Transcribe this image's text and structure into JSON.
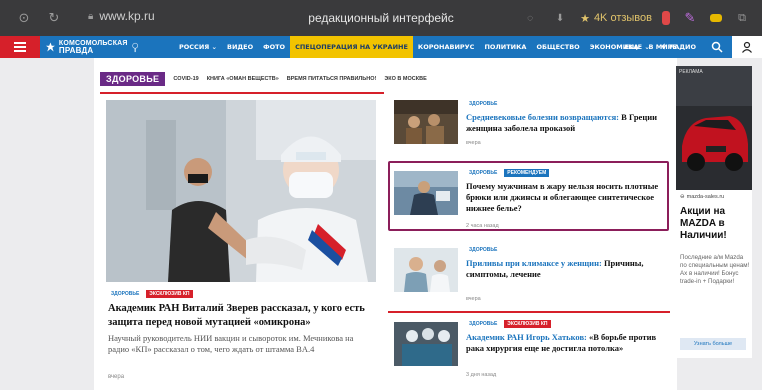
{
  "browser": {
    "url": "www.kp.ru",
    "tab_title": "редакционный интерфейс",
    "reviews": "4K отзывов"
  },
  "header": {
    "logo_line1": "КОМСОМОЛЬСКАЯ",
    "logo_line2": "ПРАВДА",
    "region": "РОССИЯ",
    "nav": [
      "ВИДЕО",
      "ФОТО",
      "СПЕЦОПЕРАЦИЯ НА УКРАИНЕ",
      "КОРОНАВИРУС",
      "ПОЛИТИКА",
      "ОБЩЕСТВО",
      "ЭКОНОМИКА",
      "В МИРЕ"
    ],
    "more": "ЕЩЕ",
    "radio": "РАДИО",
    "colors": {
      "blue": "#1b74bd",
      "red": "#d6202a",
      "special": "#f2c300"
    }
  },
  "section": {
    "rubric": "ЗДОРОВЬЕ",
    "subtags": [
      "COVID-19",
      "КНИГА «ОМАН ВЕЩЕСТВ»",
      "ВРЕМЯ ПИТАТЬСЯ ПРАВИЛЬНО!",
      "ЭКО В МОСКВЕ"
    ]
  },
  "main_story": {
    "tag1": "ЗДОРОВЬЕ",
    "tag2": "ЭКСКЛЮЗИВ КП",
    "title": "Академик РАН Виталий Зверев рассказал, у кого есть защита перед новой мутацией «омикрона»",
    "lead": "Научный руководитель НИИ вакцин и сывороток им. Мечникова на радио «КП» рассказал о том, чего ждать от штамма BA.4",
    "time": "вчера"
  },
  "cards": [
    {
      "tag1": "ЗДОРОВЬЕ",
      "tag2": "",
      "title_link": "Средневековые болезни возвращаются:",
      "title_rest": " В Греции женщина заболела проказой",
      "time": "вчера"
    },
    {
      "tag1": "ЗДОРОВЬЕ",
      "tag2": "РЕКОМЕНДУЕМ",
      "title_link": "",
      "title_rest": "Почему мужчинам в жару нельзя носить плотные брюки или джинсы и облегающее синтетическое нижнее белье?",
      "time": "2 часа назад"
    },
    {
      "tag1": "ЗДОРОВЬЕ",
      "tag2": "",
      "title_link": "Приливы при климаксе у женщин:",
      "title_rest": " Причины, симптомы, лечение",
      "time": "вчера"
    },
    {
      "tag1": "ЗДОРОВЬЕ",
      "tag2": "ЭКСКЛЮЗИВ КП",
      "title_link": "Академик РАН Игорь Хатьков:",
      "title_rest": " «В борьбе против рака хирургия еще не достигла потолка»",
      "time": "3 дня назад"
    }
  ],
  "ad": {
    "badge": "РЕКЛАМА",
    "domain": "mazda-sales.ru",
    "title": "Акции на MAZDA в Наличии!",
    "text": "Последние а/м Mazda по специальным ценам! Ах в наличии! Бонус trade-in + Подарки!",
    "button": "Узнать больше"
  }
}
